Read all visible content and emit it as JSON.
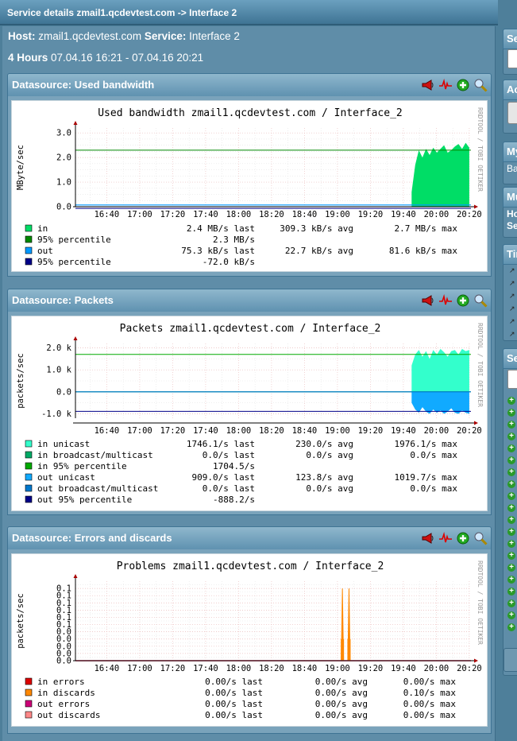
{
  "window": {
    "title": "Service details zmail1.qcdevtest.com -> Interface 2"
  },
  "header": {
    "host_label": "Host:",
    "host": "zmail1.qcdevtest.com",
    "service_label": "Service:",
    "service": "Interface 2",
    "range_label": "4 Hours",
    "range": "07.04.16 16:21 - 07.04.16 20:21"
  },
  "icons": [
    "notify-icon",
    "graph-icon",
    "add-icon",
    "zoom-icon"
  ],
  "x_ticks": [
    "16:40",
    "17:00",
    "17:20",
    "17:40",
    "18:00",
    "18:20",
    "18:40",
    "19:00",
    "19:20",
    "19:40",
    "20:00",
    "20:20"
  ],
  "watermark": "RRDTOOL / TOBI OETIKER",
  "panels": [
    {
      "header": "Datasource: Used bandwidth",
      "chart_data": {
        "type": "area",
        "title": "Used bandwidth zmail1.qcdevtest.com / Interface_2",
        "ylabel": "MByte/sec",
        "yticks": [
          "3.0",
          "2.0",
          "1.0",
          "0.0"
        ],
        "ylim": [
          0,
          3.2
        ],
        "series": [
          {
            "name": "in",
            "color": "#00dd66",
            "kind": "area",
            "start": "19:45",
            "end": "20:20",
            "level": 2.25,
            "values": [
              0.6,
              1.7,
              2.3,
              2.0,
              2.35,
              2.1,
              2.4,
              2.2,
              2.35,
              2.5,
              2.2,
              2.3,
              2.45,
              2.55,
              2.35,
              2.6,
              2.4
            ]
          },
          {
            "name": "95% percentile",
            "color": "#008800",
            "kind": "hline",
            "value": 2.3
          },
          {
            "name": "out",
            "color": "#0099ff",
            "kind": "line",
            "value": 0.07
          },
          {
            "name": "95% percentile",
            "color": "#000088",
            "kind": "hline",
            "value": -0.07
          }
        ]
      },
      "legend": [
        {
          "color": "#00dd66",
          "label": "in",
          "last": "2.4 MB/s last",
          "avg": "309.3 kB/s avg",
          "max": "2.7 MB/s max"
        },
        {
          "color": "#008800",
          "label": "95% percentile",
          "last": "2.3 MB/s",
          "avg": "",
          "max": ""
        },
        {
          "color": "#0099ff",
          "label": "out",
          "last": "75.3 kB/s last",
          "avg": "22.7 kB/s avg",
          "max": "81.6 kB/s max"
        },
        {
          "color": "#000088",
          "label": "95% percentile",
          "last": "-72.0 kB/s",
          "avg": "",
          "max": ""
        }
      ]
    },
    {
      "header": "Datasource: Packets",
      "chart_data": {
        "type": "area",
        "title": "Packets zmail1.qcdevtest.com / Interface_2",
        "ylabel": "packets/sec",
        "yticks": [
          "2.0 k",
          "1.0 k",
          "0.0",
          "-1.0 k"
        ],
        "ylim": [
          -1200,
          2200
        ],
        "series": [
          {
            "name": "in unicast",
            "color": "#33ffcc",
            "kind": "area",
            "start": "19:45",
            "end": "20:20",
            "values": [
              1200,
              1700,
              1900,
              1600,
              1850,
              1500,
              1900,
              1700,
              1950,
              1800,
              1600,
              1850,
              1900,
              1700,
              1950,
              1850,
              1900
            ]
          },
          {
            "name": "in broadcast/multicast",
            "color": "#00aa66",
            "kind": "line",
            "value": 0
          },
          {
            "name": "in 95% percentile",
            "color": "#00aa00",
            "kind": "hline",
            "value": 1704.5
          },
          {
            "name": "out unicast",
            "color": "#11aaff",
            "kind": "area",
            "start": "19:45",
            "end": "20:20",
            "values": [
              -500,
              -800,
              -950,
              -700,
              -900,
              -1000,
              -800,
              -950,
              -850,
              -1000,
              -900,
              -750,
              -950,
              -1000,
              -850,
              -950,
              -1000
            ]
          },
          {
            "name": "out broadcast/multicast",
            "color": "#0077cc",
            "kind": "line",
            "value": 0
          },
          {
            "name": "out 95% percentile",
            "color": "#000088",
            "kind": "hline",
            "value": -888.2
          }
        ]
      },
      "legend": [
        {
          "color": "#33ffcc",
          "label": "in unicast",
          "last": "1746.1/s last",
          "avg": "230.0/s avg",
          "max": "1976.1/s max"
        },
        {
          "color": "#00aa66",
          "label": "in broadcast/multicast",
          "last": "0.0/s last",
          "avg": "0.0/s avg",
          "max": "0.0/s max"
        },
        {
          "color": "#00aa00",
          "label": "in 95% percentile",
          "last": "1704.5/s",
          "avg": "",
          "max": ""
        },
        {
          "color": "#11aaff",
          "label": "out unicast",
          "last": "909.0/s last",
          "avg": "123.8/s avg",
          "max": "1019.7/s max"
        },
        {
          "color": "#0077cc",
          "label": "out broadcast/multicast",
          "last": "0.0/s last",
          "avg": "0.0/s avg",
          "max": "0.0/s max"
        },
        {
          "color": "#000088",
          "label": "out 95% percentile",
          "last": "-888.2/s",
          "avg": "",
          "max": ""
        }
      ]
    },
    {
      "header": "Datasource: Errors and discards",
      "chart_data": {
        "type": "line",
        "title": "Problems zmail1.qcdevtest.com / Interface_2",
        "ylabel": "packets/sec",
        "yticks": [
          "0.1",
          "0.1",
          "0.1",
          "0.1",
          "0.1",
          "0.1",
          "0.0",
          "0.0",
          "0.0",
          "0.0",
          "0.0"
        ],
        "ylim": [
          0,
          0.11
        ],
        "series": [
          {
            "name": "in errors",
            "color": "#dd0000",
            "kind": "line",
            "value": 0
          },
          {
            "name": "in discards",
            "color": "#ff8800",
            "kind": "spikes",
            "spikes": [
              [
                "19:03",
                0.1
              ],
              [
                "19:07",
                0.1
              ]
            ]
          },
          {
            "name": "out errors",
            "color": "#cc0077",
            "kind": "line",
            "value": 0
          },
          {
            "name": "out discards",
            "color": "#ff8888",
            "kind": "line",
            "value": 0
          }
        ]
      },
      "legend": [
        {
          "color": "#dd0000",
          "label": "in errors",
          "last": "0.00/s last",
          "avg": "0.00/s avg",
          "max": "0.00/s max"
        },
        {
          "color": "#ff8800",
          "label": "in discards",
          "last": "0.00/s last",
          "avg": "0.00/s avg",
          "max": "0.10/s max"
        },
        {
          "color": "#cc0077",
          "label": "out errors",
          "last": "0.00/s last",
          "avg": "0.00/s avg",
          "max": "0.00/s max"
        },
        {
          "color": "#ff8888",
          "label": "out discards",
          "last": "0.00/s last",
          "avg": "0.00/s avg",
          "max": "0.00/s max"
        }
      ]
    }
  ],
  "sidebar": {
    "headers": [
      "Se",
      "Ac",
      "My",
      "Mu",
      "Tir",
      "Se"
    ],
    "texts": [
      "Ba",
      "Ho",
      "Se"
    ]
  }
}
